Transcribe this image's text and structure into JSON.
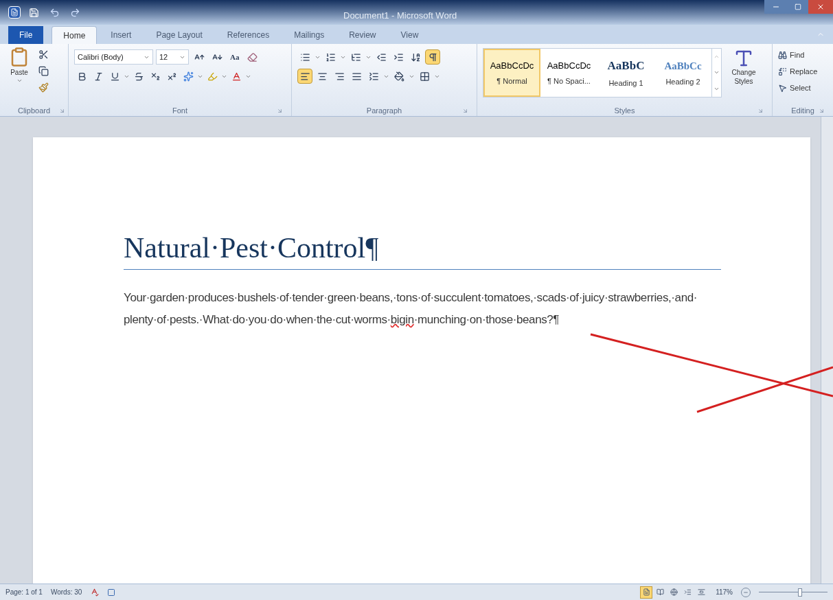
{
  "window": {
    "title": "Document1 - Microsoft Word"
  },
  "tabs": [
    {
      "label": "File",
      "kind": "file",
      "selected": false
    },
    {
      "label": "Home",
      "kind": "tab",
      "selected": true
    },
    {
      "label": "Insert",
      "kind": "tab",
      "selected": false
    },
    {
      "label": "Page Layout",
      "kind": "tab",
      "selected": false
    },
    {
      "label": "References",
      "kind": "tab",
      "selected": false
    },
    {
      "label": "Mailings",
      "kind": "tab",
      "selected": false
    },
    {
      "label": "Review",
      "kind": "tab",
      "selected": false
    },
    {
      "label": "View",
      "kind": "tab",
      "selected": false
    }
  ],
  "clipboard": {
    "paste_label": "Paste",
    "group_label": "Clipboard"
  },
  "font": {
    "name": "Calibri (Body)",
    "size": "12",
    "change_case": "Aa",
    "group_label": "Font"
  },
  "paragraph": {
    "group_label": "Paragraph",
    "show_marks": {
      "selected": true
    },
    "alignments": [
      {
        "kind": "left",
        "selected": true
      },
      {
        "kind": "center",
        "selected": false
      },
      {
        "kind": "right",
        "selected": false
      },
      {
        "kind": "justify",
        "selected": false
      }
    ]
  },
  "styles": {
    "group_label": "Styles",
    "change_styles": "Change Styles",
    "items": [
      {
        "sample": "AaBbCcDc",
        "name": "¶ Normal",
        "kind": "body",
        "selected": true
      },
      {
        "sample": "AaBbCcDc",
        "name": "¶ No Spaci...",
        "kind": "body",
        "selected": false
      },
      {
        "sample": "AaBbC",
        "name": "Heading 1",
        "kind": "heading1",
        "selected": false
      },
      {
        "sample": "AaBbCc",
        "name": "Heading 2",
        "kind": "heading2",
        "selected": false
      }
    ]
  },
  "editing": {
    "group_label": "Editing",
    "items": [
      {
        "label": "Find",
        "kind": "find"
      },
      {
        "label": "Replace",
        "kind": "replace"
      },
      {
        "label": "Select",
        "kind": "select"
      }
    ]
  },
  "document": {
    "title": "Natural·Pest·Control¶",
    "paragraph": {
      "before": "Your·garden·produces·bushels·of·tender·green·beans,·tons·of·succulent·tomatoes,·scads·of·juicy·strawberries,·and·plenty·of·pests.·What·do·you·do·when·the·cut·worms·",
      "misspelled": "bigin",
      "after": "·munching·on·those·beans?¶"
    }
  },
  "status_bar": {
    "page": "Page: 1 of 1",
    "words": "Words: 30",
    "zoom": "117%",
    "zoom_slider": {
      "level": 0.6
    },
    "views": [
      {
        "kind": "print",
        "selected": true
      },
      {
        "kind": "reading",
        "selected": false
      },
      {
        "kind": "web",
        "selected": false
      },
      {
        "kind": "outline",
        "selected": false
      },
      {
        "kind": "draft",
        "selected": false
      }
    ]
  }
}
